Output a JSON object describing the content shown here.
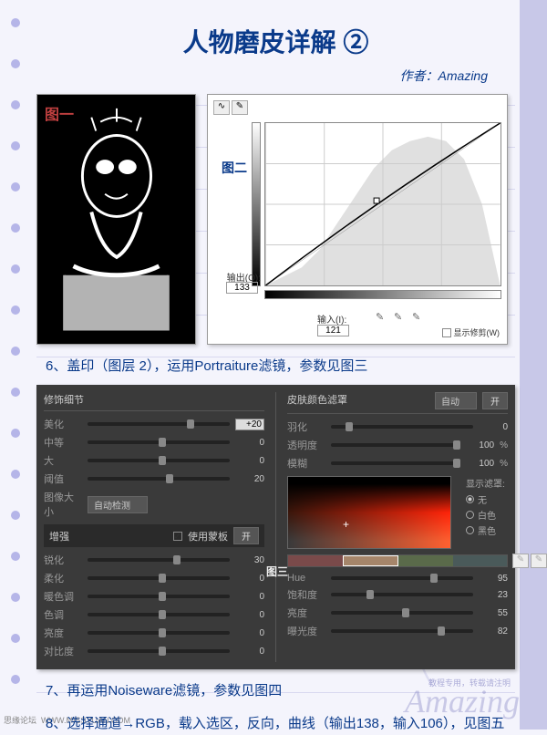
{
  "title": "人物磨皮详解 ②",
  "author": "作者：Amazing",
  "fig1_label": "图一",
  "fig2_label": "图二",
  "fig3_label": "图三",
  "curves": {
    "output_label": "输出(O):",
    "output_value": "133",
    "input_label": "输入(I):",
    "input_value": "121",
    "show_clip": "显示修剪(W)"
  },
  "step6": "6、盖印（图层 2），运用Portraiture滤镜，参数见图三",
  "step7": "7、再运用Noiseware滤镜，参数见图四",
  "step8": "8、选择通道→RGB，载入选区，反向，曲线（输出138，输入106），见图五",
  "panel": {
    "left_header": "修饰细节",
    "right_header": "皮肤颜色滤罩",
    "auto": "自动",
    "open": "开",
    "detail": {
      "smoothing": {
        "label": "美化",
        "value": "+20"
      },
      "medium": {
        "label": "中等",
        "value": "0"
      },
      "large": {
        "label": "大",
        "value": "0"
      },
      "threshold": {
        "label": "阈值",
        "value": "20"
      }
    },
    "image_size_label": "图像大小",
    "image_size_value": "自动检测",
    "enhance_header": "增强",
    "use_mask": "使用蒙板",
    "enhance": {
      "sharpen": {
        "label": "锐化",
        "value": "30"
      },
      "soften": {
        "label": "柔化",
        "value": "0"
      },
      "warmth": {
        "label": "暖色调",
        "value": "0"
      },
      "hue": {
        "label": "色调",
        "value": "0"
      },
      "brightness": {
        "label": "亮度",
        "value": "0"
      },
      "contrast": {
        "label": "对比度",
        "value": "0"
      }
    },
    "mask": {
      "feather": {
        "label": "羽化",
        "value": "0"
      },
      "opacity": {
        "label": "透明度",
        "value": "100",
        "unit": "%"
      },
      "blur": {
        "label": "模糊",
        "value": "100",
        "unit": "%"
      }
    },
    "show_mask_label": "显示滤罩:",
    "radio_none": "无",
    "radio_white": "白色",
    "radio_black": "黑色",
    "color": {
      "hue": {
        "label": "Hue",
        "value": "95"
      },
      "sat": {
        "label": "饱和度",
        "value": "23"
      },
      "bright": {
        "label": "亮度",
        "value": "55"
      },
      "exposure": {
        "label": "曝光度",
        "value": "82"
      }
    }
  },
  "watermark": "Amazing",
  "watermark_note": "教程专用，转载请注明",
  "footer_left": "思缘论坛",
  "footer_url": "WWW.MISSYUAN.COM",
  "chart_data": {
    "type": "line",
    "title": "Curves (图二)",
    "xlabel": "输入",
    "ylabel": "输出",
    "xlim": [
      0,
      255
    ],
    "ylim": [
      0,
      255
    ],
    "series": [
      {
        "name": "curve",
        "x": [
          0,
          121,
          255
        ],
        "y": [
          0,
          133,
          255
        ]
      }
    ],
    "annotations": {
      "input": 121,
      "output": 133
    }
  }
}
